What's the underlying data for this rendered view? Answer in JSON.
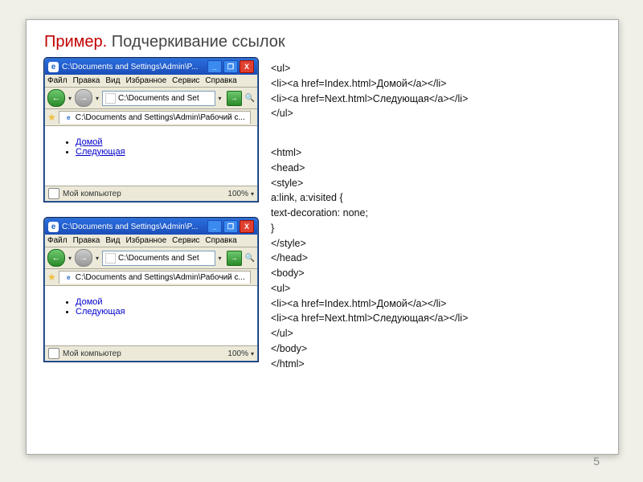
{
  "title": {
    "red": "Пример.",
    "rest": "Подчеркивание ссылок"
  },
  "code1": "<ul>\n<li><a href=Index.html>Домой</a></li>\n<li><a href=Next.html>Следующая</a></li>\n</ul>",
  "code2": "<html>\n<head>\n<style>\na:link, a:visited {\ntext-decoration: none;\n}\n</style>\n</head>\n<body>\n<ul>\n<li><a href=Index.html>Домой</a></li>\n<li><a href=Next.html>Следующая</a></li>\n</ul>\n</body>\n</html>",
  "browser": {
    "title": "C:\\Documents and Settings\\Admin\\P...",
    "ieGlyph": "e",
    "menus": [
      "Файл",
      "Правка",
      "Вид",
      "Избранное",
      "Сервис",
      "Справка"
    ],
    "address": "C:\\Documents and Set",
    "tab": "C:\\Documents and Settings\\Admin\\Рабочий с...",
    "status": "Мой компьютер",
    "zoom": "100%",
    "minGlyph": "_",
    "maxGlyph": "❐",
    "closeGlyph": "X",
    "backGlyph": "←",
    "fwdGlyph": "→",
    "goGlyph": "→",
    "chevGlyph": "▾",
    "starGlyph": "★",
    "tabIeGlyph": "e"
  },
  "links": {
    "home": "Домой",
    "next": "Следующая"
  },
  "pageNumber": "5"
}
